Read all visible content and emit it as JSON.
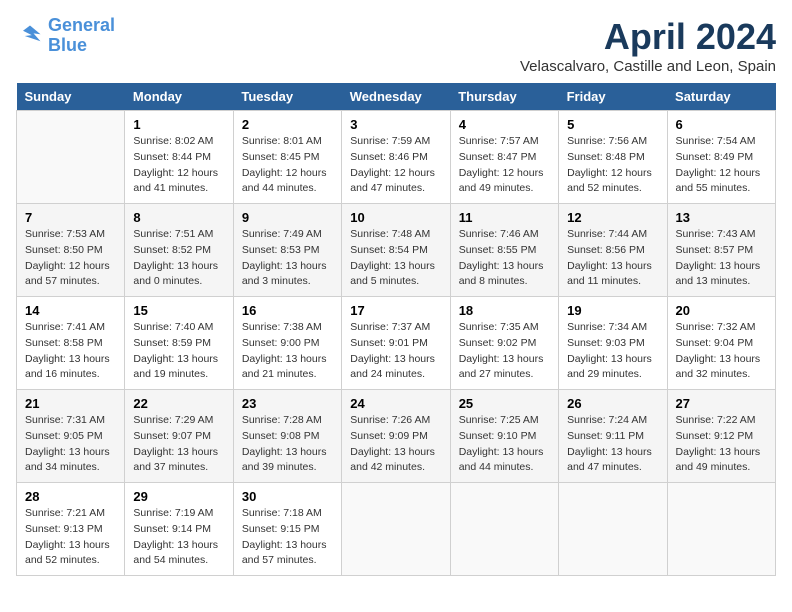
{
  "header": {
    "logo_line1": "General",
    "logo_line2": "Blue",
    "month_title": "April 2024",
    "location": "Velascalvaro, Castille and Leon, Spain"
  },
  "calendar": {
    "days_of_week": [
      "Sunday",
      "Monday",
      "Tuesday",
      "Wednesday",
      "Thursday",
      "Friday",
      "Saturday"
    ],
    "weeks": [
      [
        {
          "day": "",
          "sunrise": "",
          "sunset": "",
          "daylight": ""
        },
        {
          "day": "1",
          "sunrise": "Sunrise: 8:02 AM",
          "sunset": "Sunset: 8:44 PM",
          "daylight": "Daylight: 12 hours and 41 minutes."
        },
        {
          "day": "2",
          "sunrise": "Sunrise: 8:01 AM",
          "sunset": "Sunset: 8:45 PM",
          "daylight": "Daylight: 12 hours and 44 minutes."
        },
        {
          "day": "3",
          "sunrise": "Sunrise: 7:59 AM",
          "sunset": "Sunset: 8:46 PM",
          "daylight": "Daylight: 12 hours and 47 minutes."
        },
        {
          "day": "4",
          "sunrise": "Sunrise: 7:57 AM",
          "sunset": "Sunset: 8:47 PM",
          "daylight": "Daylight: 12 hours and 49 minutes."
        },
        {
          "day": "5",
          "sunrise": "Sunrise: 7:56 AM",
          "sunset": "Sunset: 8:48 PM",
          "daylight": "Daylight: 12 hours and 52 minutes."
        },
        {
          "day": "6",
          "sunrise": "Sunrise: 7:54 AM",
          "sunset": "Sunset: 8:49 PM",
          "daylight": "Daylight: 12 hours and 55 minutes."
        }
      ],
      [
        {
          "day": "7",
          "sunrise": "Sunrise: 7:53 AM",
          "sunset": "Sunset: 8:50 PM",
          "daylight": "Daylight: 12 hours and 57 minutes."
        },
        {
          "day": "8",
          "sunrise": "Sunrise: 7:51 AM",
          "sunset": "Sunset: 8:52 PM",
          "daylight": "Daylight: 13 hours and 0 minutes."
        },
        {
          "day": "9",
          "sunrise": "Sunrise: 7:49 AM",
          "sunset": "Sunset: 8:53 PM",
          "daylight": "Daylight: 13 hours and 3 minutes."
        },
        {
          "day": "10",
          "sunrise": "Sunrise: 7:48 AM",
          "sunset": "Sunset: 8:54 PM",
          "daylight": "Daylight: 13 hours and 5 minutes."
        },
        {
          "day": "11",
          "sunrise": "Sunrise: 7:46 AM",
          "sunset": "Sunset: 8:55 PM",
          "daylight": "Daylight: 13 hours and 8 minutes."
        },
        {
          "day": "12",
          "sunrise": "Sunrise: 7:44 AM",
          "sunset": "Sunset: 8:56 PM",
          "daylight": "Daylight: 13 hours and 11 minutes."
        },
        {
          "day": "13",
          "sunrise": "Sunrise: 7:43 AM",
          "sunset": "Sunset: 8:57 PM",
          "daylight": "Daylight: 13 hours and 13 minutes."
        }
      ],
      [
        {
          "day": "14",
          "sunrise": "Sunrise: 7:41 AM",
          "sunset": "Sunset: 8:58 PM",
          "daylight": "Daylight: 13 hours and 16 minutes."
        },
        {
          "day": "15",
          "sunrise": "Sunrise: 7:40 AM",
          "sunset": "Sunset: 8:59 PM",
          "daylight": "Daylight: 13 hours and 19 minutes."
        },
        {
          "day": "16",
          "sunrise": "Sunrise: 7:38 AM",
          "sunset": "Sunset: 9:00 PM",
          "daylight": "Daylight: 13 hours and 21 minutes."
        },
        {
          "day": "17",
          "sunrise": "Sunrise: 7:37 AM",
          "sunset": "Sunset: 9:01 PM",
          "daylight": "Daylight: 13 hours and 24 minutes."
        },
        {
          "day": "18",
          "sunrise": "Sunrise: 7:35 AM",
          "sunset": "Sunset: 9:02 PM",
          "daylight": "Daylight: 13 hours and 27 minutes."
        },
        {
          "day": "19",
          "sunrise": "Sunrise: 7:34 AM",
          "sunset": "Sunset: 9:03 PM",
          "daylight": "Daylight: 13 hours and 29 minutes."
        },
        {
          "day": "20",
          "sunrise": "Sunrise: 7:32 AM",
          "sunset": "Sunset: 9:04 PM",
          "daylight": "Daylight: 13 hours and 32 minutes."
        }
      ],
      [
        {
          "day": "21",
          "sunrise": "Sunrise: 7:31 AM",
          "sunset": "Sunset: 9:05 PM",
          "daylight": "Daylight: 13 hours and 34 minutes."
        },
        {
          "day": "22",
          "sunrise": "Sunrise: 7:29 AM",
          "sunset": "Sunset: 9:07 PM",
          "daylight": "Daylight: 13 hours and 37 minutes."
        },
        {
          "day": "23",
          "sunrise": "Sunrise: 7:28 AM",
          "sunset": "Sunset: 9:08 PM",
          "daylight": "Daylight: 13 hours and 39 minutes."
        },
        {
          "day": "24",
          "sunrise": "Sunrise: 7:26 AM",
          "sunset": "Sunset: 9:09 PM",
          "daylight": "Daylight: 13 hours and 42 minutes."
        },
        {
          "day": "25",
          "sunrise": "Sunrise: 7:25 AM",
          "sunset": "Sunset: 9:10 PM",
          "daylight": "Daylight: 13 hours and 44 minutes."
        },
        {
          "day": "26",
          "sunrise": "Sunrise: 7:24 AM",
          "sunset": "Sunset: 9:11 PM",
          "daylight": "Daylight: 13 hours and 47 minutes."
        },
        {
          "day": "27",
          "sunrise": "Sunrise: 7:22 AM",
          "sunset": "Sunset: 9:12 PM",
          "daylight": "Daylight: 13 hours and 49 minutes."
        }
      ],
      [
        {
          "day": "28",
          "sunrise": "Sunrise: 7:21 AM",
          "sunset": "Sunset: 9:13 PM",
          "daylight": "Daylight: 13 hours and 52 minutes."
        },
        {
          "day": "29",
          "sunrise": "Sunrise: 7:19 AM",
          "sunset": "Sunset: 9:14 PM",
          "daylight": "Daylight: 13 hours and 54 minutes."
        },
        {
          "day": "30",
          "sunrise": "Sunrise: 7:18 AM",
          "sunset": "Sunset: 9:15 PM",
          "daylight": "Daylight: 13 hours and 57 minutes."
        },
        {
          "day": "",
          "sunrise": "",
          "sunset": "",
          "daylight": ""
        },
        {
          "day": "",
          "sunrise": "",
          "sunset": "",
          "daylight": ""
        },
        {
          "day": "",
          "sunrise": "",
          "sunset": "",
          "daylight": ""
        },
        {
          "day": "",
          "sunrise": "",
          "sunset": "",
          "daylight": ""
        }
      ]
    ]
  }
}
